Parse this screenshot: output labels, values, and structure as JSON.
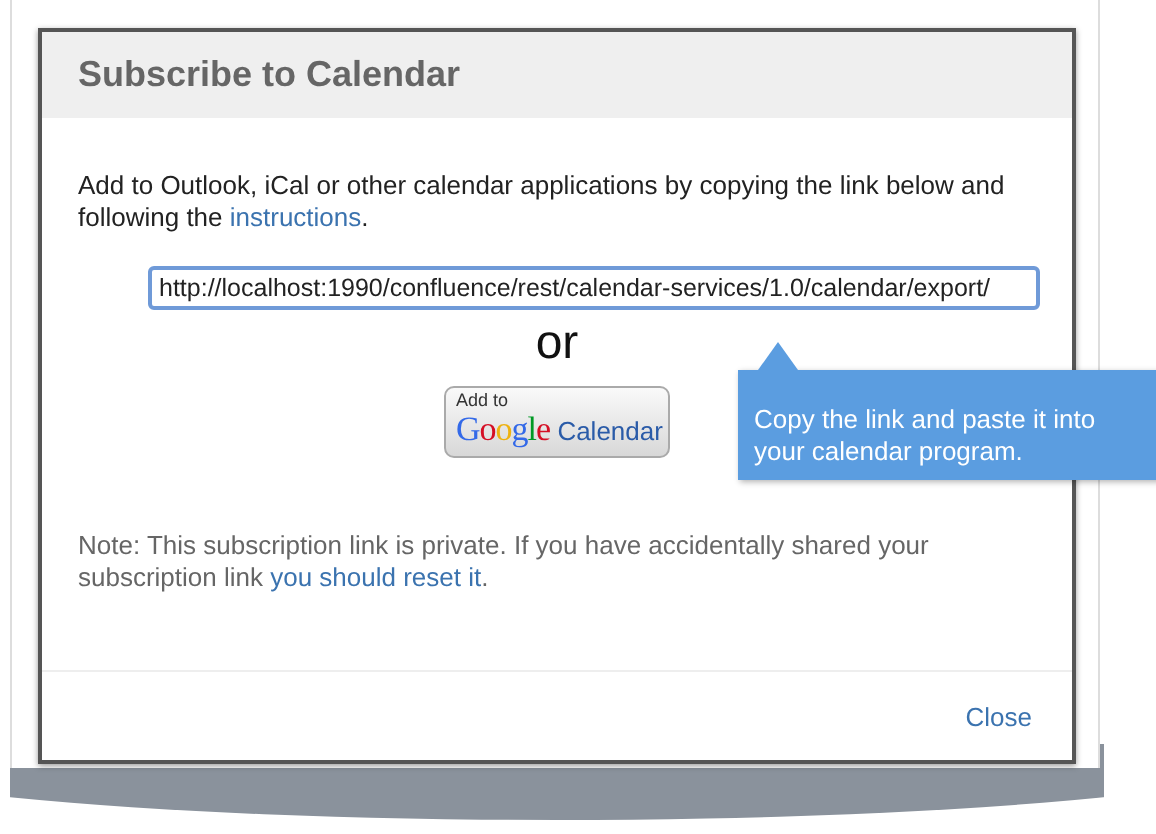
{
  "dialog": {
    "title": "Subscribe to Calendar",
    "intro": {
      "before": "Add to Outlook, iCal or other calendar applications by copying the link below and following the ",
      "link": "instructions",
      "after": "."
    },
    "link_field": {
      "value": "http://localhost:1990/confluence/rest/calendar-services/1.0/calendar/export/"
    },
    "separator": "or",
    "google_button": {
      "small": "Add to",
      "brand": "Google",
      "label": "Calendar"
    },
    "tooltip": "Copy the link and paste it into your calendar program.",
    "note": {
      "before": "Note: This subscription link is private. If you have accidentally shared your subscription link ",
      "link": "you should reset it",
      "after": "."
    },
    "buttons": [
      "Close"
    ]
  }
}
